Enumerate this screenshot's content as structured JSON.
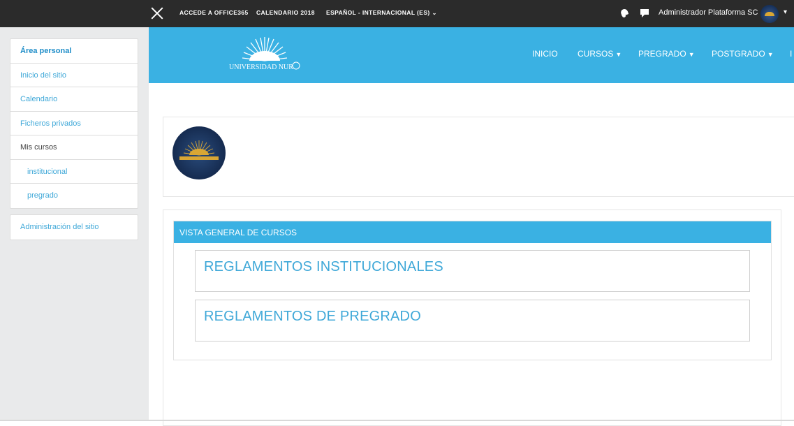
{
  "topbar": {
    "links": [
      {
        "label": "ACCEDE A OFFICE365"
      },
      {
        "label": "CALENDARIO 2018"
      },
      {
        "label": "ESPAÑOL - INTERNACIONAL (ES)"
      }
    ],
    "username": "Administrador Plataforma SC",
    "chevron": "⌄"
  },
  "sidebar": {
    "items": [
      {
        "label": "Área personal"
      },
      {
        "label": "Inicio del sitio"
      },
      {
        "label": "Calendario"
      },
      {
        "label": "Ficheros privados"
      },
      {
        "label": "Mis cursos"
      },
      {
        "label": "institucional"
      },
      {
        "label": "pregrado"
      }
    ],
    "admin": {
      "label": "Administración del sitio"
    }
  },
  "header": {
    "logo_text": "UNIVERSIDAD NUR",
    "nav": [
      {
        "label": "INICIO"
      },
      {
        "label": "CURSOS"
      },
      {
        "label": "PREGRADO"
      },
      {
        "label": "POSTGRADO"
      },
      {
        "label": "I"
      }
    ]
  },
  "main": {
    "block_title": "VISTA GENERAL DE CURSOS",
    "courses": [
      {
        "name": "REGLAMENTOS INSTITUCIONALES"
      },
      {
        "name": "REGLAMENTOS DE PREGRADO"
      }
    ]
  },
  "colors": {
    "accent": "#3ab1e3",
    "link": "#3fa8d8",
    "topbar": "#2b2b2b",
    "sidebar_bg": "#e9eaeb",
    "logo_gold": "#d9a634"
  }
}
